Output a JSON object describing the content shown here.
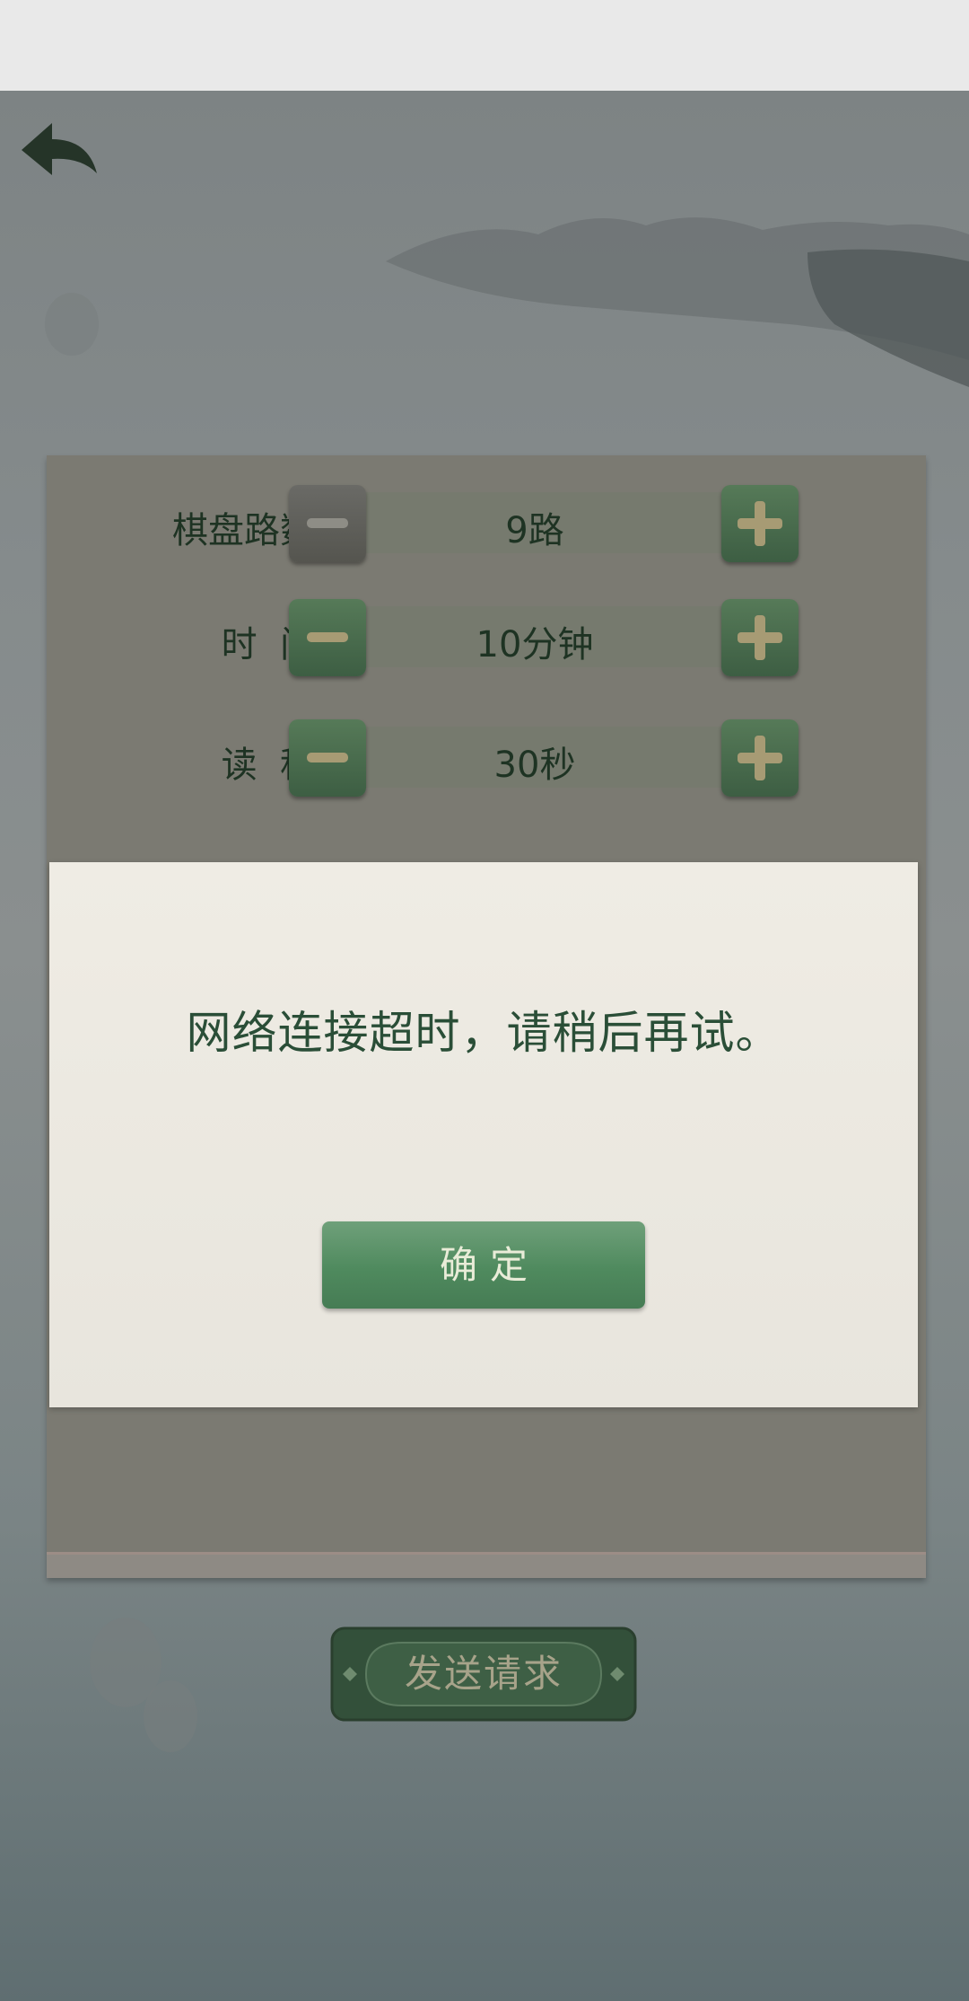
{
  "settings": {
    "board_size": {
      "label": "棋盘路数",
      "value": "9路"
    },
    "time": {
      "label": "时  间",
      "value": "10分钟"
    },
    "byoyomi": {
      "label": "读  秒",
      "value": "30秒"
    }
  },
  "send_button": {
    "label": "发送请求"
  },
  "dialog": {
    "message": "网络连接超时，请稍后再试。",
    "confirm_label": "确定"
  },
  "icons": {
    "back": "back-arrow-icon",
    "minus": "minus-icon",
    "plus": "plus-icon"
  },
  "colors": {
    "accent_green": "#4f8a5e",
    "text_dark_green": "#2a4e37",
    "dialog_bg": "#efece4"
  }
}
